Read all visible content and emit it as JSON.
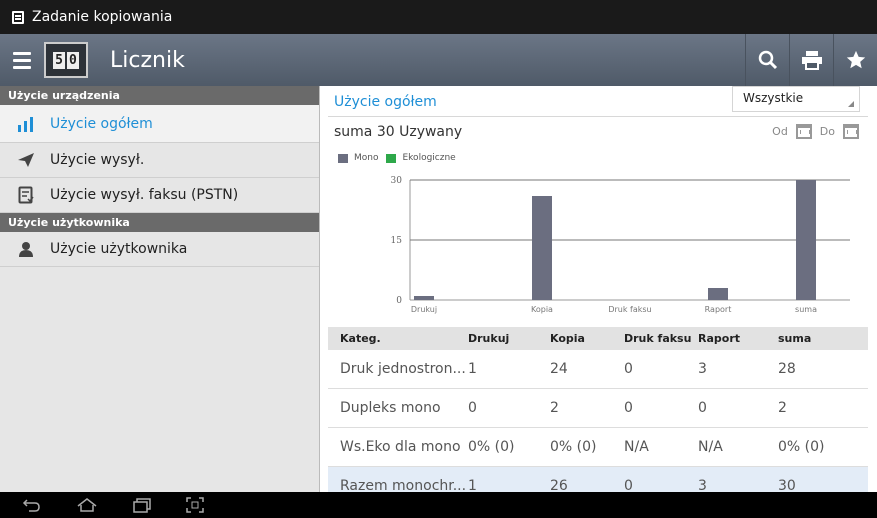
{
  "status_bar": {
    "title": "Zadanie kopiowania",
    "icon": "document-icon"
  },
  "app_bar": {
    "title": "Licznik",
    "logo_digits": [
      "5",
      "0"
    ],
    "actions": [
      "search-icon",
      "print-icon",
      "star-icon"
    ]
  },
  "sidebar": {
    "sections": [
      {
        "header": "Użycie urządzenia",
        "items": [
          {
            "label": "Użycie ogółem",
            "icon": "bar-chart-icon",
            "active": true
          },
          {
            "label": "Użycie wysył.",
            "icon": "send-icon"
          },
          {
            "label": "Użycie wysył. faksu (PSTN)",
            "icon": "fax-icon"
          }
        ]
      },
      {
        "header": "Użycie użytkownika",
        "items": [
          {
            "label": "Użycie użytkownika",
            "icon": "user-icon"
          }
        ]
      }
    ]
  },
  "content": {
    "title": "Użycie ogółem",
    "filter": "Wszystkie",
    "summary": "suma 30 Uzywany",
    "date_from_label": "Od",
    "date_to_label": "Do"
  },
  "legend": [
    {
      "label": "Mono",
      "color": "#6b6e80"
    },
    {
      "label": "Ekologiczne",
      "color": "#2ea84a"
    }
  ],
  "chart_data": {
    "type": "bar",
    "categories": [
      "Drukuj",
      "Kopia",
      "Druk faksu",
      "Raport",
      "suma"
    ],
    "series": [
      {
        "name": "Mono",
        "values": [
          1,
          26,
          0,
          3,
          30
        ],
        "color": "#6b6e80"
      },
      {
        "name": "Ekologiczne",
        "values": [
          0,
          0,
          0,
          0,
          0
        ],
        "color": "#2ea84a"
      }
    ],
    "yticks": [
      0,
      15,
      30
    ],
    "ylim": [
      0,
      30
    ],
    "grid": true
  },
  "table": {
    "headers": [
      "Kateg.",
      "Drukuj",
      "Kopia",
      "Druk faksu",
      "Raport",
      "suma"
    ],
    "rows": [
      [
        "Druk jednostron...",
        "1",
        "24",
        "0",
        "3",
        "28"
      ],
      [
        "Dupleks mono",
        "0",
        "2",
        "0",
        "0",
        "2"
      ],
      [
        "Ws.Eko dla mono",
        "0% (0)",
        "0% (0)",
        "N/A",
        "N/A",
        "0% (0)"
      ],
      [
        "Razem monochr...",
        "1",
        "26",
        "0",
        "3",
        "30"
      ]
    ]
  },
  "nav_bar": [
    "back-icon",
    "home-icon",
    "recent-apps-icon",
    "screenshot-icon"
  ]
}
